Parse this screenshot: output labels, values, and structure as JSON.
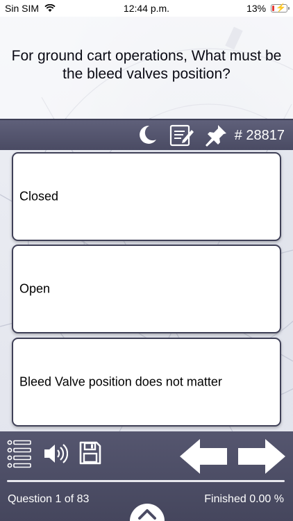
{
  "status_bar": {
    "carrier": "Sin SIM",
    "time": "12:44 p.m.",
    "battery": "13%",
    "battery_level": 0.13,
    "battery_color": "#e53935"
  },
  "question": {
    "text": "For ground cart operations, What must be the bleed valves position?"
  },
  "toolbar": {
    "icons": [
      "moon-icon",
      "notepad-icon",
      "pushpin-icon"
    ],
    "question_number": "# 28817"
  },
  "answers": [
    {
      "label": "Closed"
    },
    {
      "label": "Open"
    },
    {
      "label": "Bleed Valve position does not matter"
    }
  ],
  "bottom_bar": {
    "icons": [
      "list-icon",
      "speaker-icon",
      "save-icon",
      "arrow-left-icon",
      "arrow-right-icon",
      "chevron-up-icon"
    ],
    "question_counter": "Question 1 of 83",
    "finished": "Finished 0.00 %",
    "progress": 0.0
  },
  "colors": {
    "toolbar": "#4f5069",
    "card_border": "#3f4057",
    "text": "#0a0a14"
  }
}
